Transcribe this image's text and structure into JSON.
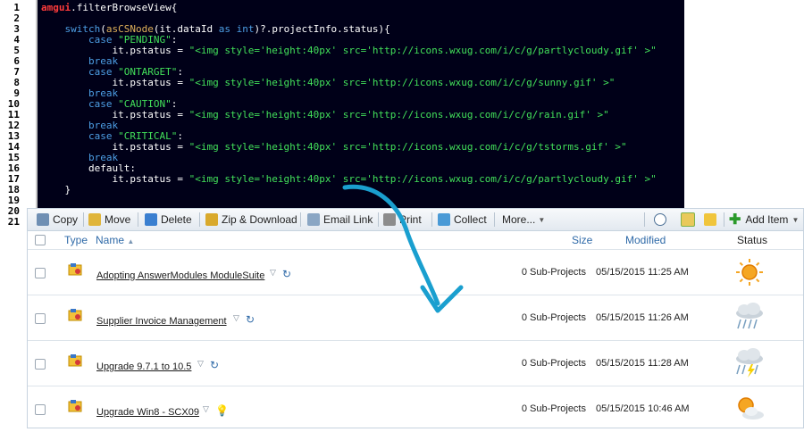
{
  "code": {
    "line_numbers": [
      "1",
      "2",
      "3",
      "4",
      "5",
      "6",
      "7",
      "8",
      "9",
      "10",
      "11",
      "12",
      "13",
      "14",
      "15",
      "16",
      "17",
      "18",
      "19",
      "20",
      "21"
    ],
    "lines": [
      [
        {
          "t": "amgui",
          "c": "rd"
        },
        {
          "t": ".filterBrowseView{",
          "c": ""
        }
      ],
      [],
      [
        {
          "t": "    ",
          "c": ""
        },
        {
          "t": "switch",
          "c": "kw"
        },
        {
          "t": "(",
          "c": ""
        },
        {
          "t": "asCSNode",
          "c": "fn"
        },
        {
          "t": "(it.dataId ",
          "c": ""
        },
        {
          "t": "as int",
          "c": "kw"
        },
        {
          "t": ")?.projectInfo.status){",
          "c": ""
        }
      ],
      [
        {
          "t": "        ",
          "c": ""
        },
        {
          "t": "case ",
          "c": "kw"
        },
        {
          "t": "\"PENDING\"",
          "c": "st"
        },
        {
          "t": ":",
          "c": ""
        }
      ],
      [
        {
          "t": "            it.pstatus = ",
          "c": ""
        },
        {
          "t": "\"<img style='height:40px' src='http://icons.wxug.com/i/c/g/partlycloudy.gif' >\"",
          "c": "st"
        }
      ],
      [
        {
          "t": "        ",
          "c": ""
        },
        {
          "t": "break",
          "c": "kw"
        }
      ],
      [
        {
          "t": "        ",
          "c": ""
        },
        {
          "t": "case ",
          "c": "kw"
        },
        {
          "t": "\"ONTARGET\"",
          "c": "st"
        },
        {
          "t": ":",
          "c": ""
        }
      ],
      [
        {
          "t": "            it.pstatus = ",
          "c": ""
        },
        {
          "t": "\"<img style='height:40px' src='http://icons.wxug.com/i/c/g/sunny.gif' >\"",
          "c": "st"
        }
      ],
      [
        {
          "t": "        ",
          "c": ""
        },
        {
          "t": "break",
          "c": "kw"
        }
      ],
      [
        {
          "t": "        ",
          "c": ""
        },
        {
          "t": "case ",
          "c": "kw"
        },
        {
          "t": "\"CAUTION\"",
          "c": "st"
        },
        {
          "t": ":",
          "c": ""
        }
      ],
      [
        {
          "t": "            it.pstatus = ",
          "c": ""
        },
        {
          "t": "\"<img style='height:40px' src='http://icons.wxug.com/i/c/g/rain.gif' >\"",
          "c": "st"
        }
      ],
      [
        {
          "t": "        ",
          "c": ""
        },
        {
          "t": "break",
          "c": "kw"
        }
      ],
      [
        {
          "t": "        ",
          "c": ""
        },
        {
          "t": "case ",
          "c": "kw"
        },
        {
          "t": "\"CRITICAL\"",
          "c": "st"
        },
        {
          "t": ":",
          "c": ""
        }
      ],
      [
        {
          "t": "            it.pstatus = ",
          "c": ""
        },
        {
          "t": "\"<img style='height:40px' src='http://icons.wxug.com/i/c/g/tstorms.gif' >\"",
          "c": "st"
        }
      ],
      [
        {
          "t": "        ",
          "c": ""
        },
        {
          "t": "break",
          "c": "kw"
        }
      ],
      [
        {
          "t": "        default:",
          "c": ""
        }
      ],
      [
        {
          "t": "            it.pstatus = ",
          "c": ""
        },
        {
          "t": "\"<img style='height:40px' src='http://icons.wxug.com/i/c/g/partlycloudy.gif' >\"",
          "c": "st"
        }
      ],
      [
        {
          "t": "    }",
          "c": ""
        }
      ],
      [],
      [],
      []
    ]
  },
  "toolbar": {
    "copy": "Copy",
    "move": "Move",
    "delete": "Delete",
    "zip": "Zip & Download",
    "email": "Email Link",
    "print": "Print",
    "collect": "Collect",
    "more": "More...",
    "add_item": "Add Item"
  },
  "columns": {
    "type": "Type",
    "name": "Name",
    "size": "Size",
    "modified": "Modified",
    "status": "Status"
  },
  "rows": [
    {
      "name": "Adopting AnswerModules ModuleSuite",
      "size": "0 Sub-Projects",
      "modified": "05/15/2015 11:25 AM",
      "status": "sunny-icon",
      "extra": "refresh"
    },
    {
      "name": "Supplier Invoice Management",
      "size": "0 Sub-Projects",
      "modified": "05/15/2015 11:26 AM",
      "status": "rain-icon",
      "extra": "refresh"
    },
    {
      "name": "Upgrade 9.7.1 to 10.5",
      "size": "0 Sub-Projects",
      "modified": "05/15/2015 11:28 AM",
      "status": "tstorms-icon",
      "extra": "refresh"
    },
    {
      "name": "Upgrade Win8 - SCX09",
      "size": "0 Sub-Projects",
      "modified": "05/15/2015 10:46 AM",
      "status": "partlycloudy-icon",
      "extra": "bulb"
    }
  ],
  "colors": {
    "arrow": "#1a9fcf",
    "link": "#2f6aa8",
    "editor_bg": "#000018"
  }
}
